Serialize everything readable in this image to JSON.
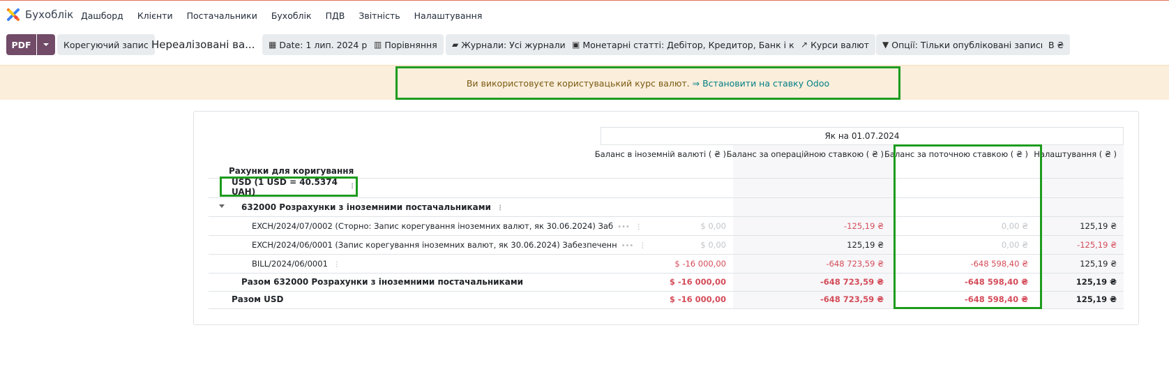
{
  "app": {
    "name": "Бухоблік"
  },
  "menu": [
    "Дашборд",
    "Клієнти",
    "Постачальники",
    "Бухоблік",
    "ПДВ",
    "Звітність",
    "Налаштування"
  ],
  "toolbar": {
    "pdf": "PDF",
    "adjust": "Корегуючий запис",
    "report_title": "Нереалізовані ва...",
    "date": "Date: 1 лип. 2024 р.",
    "comparison": "Порівняння",
    "journals": "Журнали: Усі журнали",
    "monetary": "Монетарні статті: Дебітор, Кредитор, Банк і каса",
    "rates": "Курси валют",
    "options": "Опції: Тільки опубліковані записи",
    "currency": "В ₴"
  },
  "alert": {
    "text": "Ви використовуєте користувацький курс валют.",
    "link": "⇒ Встановити на ставку Odoo"
  },
  "report": {
    "date_header": "Як на 01.07.2024",
    "accounts_header": "Рахунки для коригування",
    "columns": [
      "Баланс в іноземній валюті ( ₴ )",
      "Баланс за операційною ставкою ( ₴ )",
      "Баланс за поточною ставкою ( ₴ )",
      "Налаштування ( ₴ )"
    ],
    "currency_line": "USD (1 USD = 40.5374 UAH)",
    "account_line": "632000 Розрахунки з іноземними постачальниками",
    "lines": [
      {
        "label": "EXCH/2024/07/0002 (Сторно: Запис корегування іноземних валют, як 30.06.2024) Заб",
        "v": [
          "$ 0,00",
          "-125,19 ₴",
          "0,00 ₴",
          "125,19 ₴"
        ]
      },
      {
        "label": "EXCH/2024/06/0001 (Запис корегування іноземних валют, як 30.06.2024) Забезпеченн",
        "v": [
          "$ 0,00",
          "125,19 ₴",
          "0,00 ₴",
          "-125,19 ₴"
        ]
      },
      {
        "label": "BILL/2024/06/0001",
        "v": [
          "$ -16 000,00",
          "-648 723,59 ₴",
          "-648 598,40 ₴",
          "125,19 ₴"
        ]
      }
    ],
    "subtotal": {
      "label": "Разом 632000 Розрахунки з іноземними постачальниками",
      "v": [
        "$ -16 000,00",
        "-648 723,59 ₴",
        "-648 598,40 ₴",
        "125,19 ₴"
      ]
    },
    "total": {
      "label": "Разом USD",
      "v": [
        "$ -16 000,00",
        "-648 723,59 ₴",
        "-648 598,40 ₴",
        "125,19 ₴"
      ]
    }
  },
  "colors": {
    "accent": "#714b67",
    "highlight": "#1d9b1d",
    "negative": "#d44c59",
    "alert_bg": "#fbeedb"
  }
}
